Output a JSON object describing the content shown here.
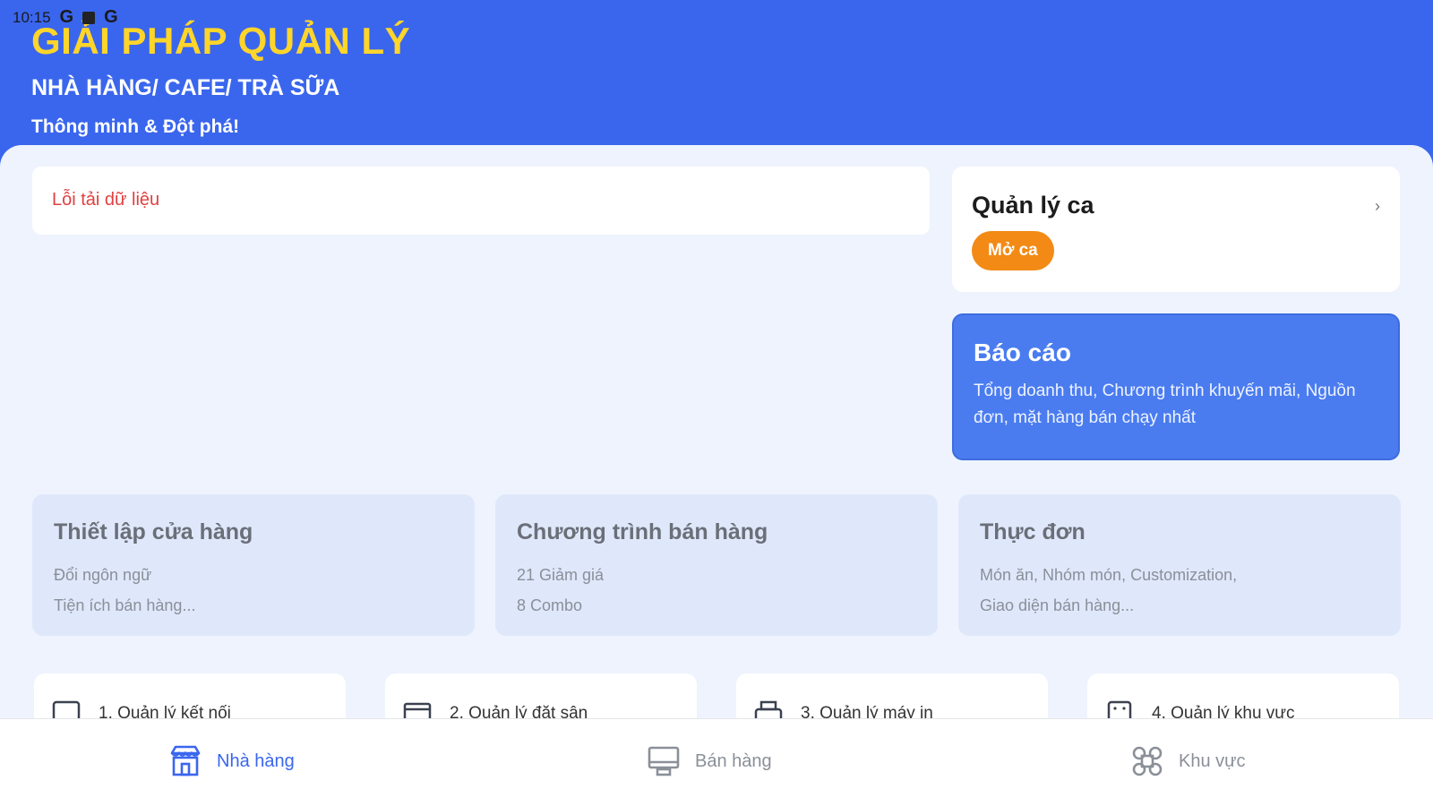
{
  "status_bar": {
    "time": "10:15",
    "g1": "G",
    "g2": "G"
  },
  "header": {
    "title": "GIẢI PHÁP QUẢN LÝ",
    "subtitle": "NHÀ HÀNG/ CAFE/ TRÀ SỮA",
    "tagline": "Thông minh & Đột phá!"
  },
  "error_message": "Lỗi tải dữ liệu",
  "shift": {
    "title": "Quản lý ca",
    "open_button": "Mở ca",
    "chevron": "›"
  },
  "report": {
    "title": "Báo cáo",
    "description": "Tổng doanh thu, Chương trình khuyến mãi, Nguồn đơn, mặt hàng bán chạy nhất"
  },
  "features": [
    {
      "title": "Thiết lập cửa hàng",
      "line1": "Đổi ngôn ngữ",
      "line2": "Tiện ích bán hàng..."
    },
    {
      "title": "Chương trình bán hàng",
      "line1": "21 Giảm giá",
      "line2": "8 Combo"
    },
    {
      "title": "Thực đơn",
      "line1": "Món ăn, Nhóm món, Customization,",
      "line2": "Giao diện bán hàng..."
    }
  ],
  "shortcuts": [
    {
      "label": "1. Quản lý kết nối",
      "icon": "device-icon"
    },
    {
      "label": "2. Quản lý đặt sân",
      "icon": "booking-icon"
    },
    {
      "label": "3. Quản lý máy in",
      "icon": "printer-icon"
    },
    {
      "label": "4. Quản lý khu vực",
      "icon": "area-icon"
    }
  ],
  "bottom_nav": [
    {
      "label": "Nhà hàng",
      "icon": "store-icon",
      "active": true
    },
    {
      "label": "Bán hàng",
      "icon": "pos-icon",
      "active": false
    },
    {
      "label": "Khu vực",
      "icon": "area-grid-icon",
      "active": false
    }
  ],
  "colors": {
    "primary": "#3a66ee",
    "title_yellow": "#ffd52a",
    "accent_orange": "#f28a15",
    "error_red": "#e04040",
    "report_blue": "#4a7cf0",
    "feature_bg": "#dfe8fb"
  }
}
